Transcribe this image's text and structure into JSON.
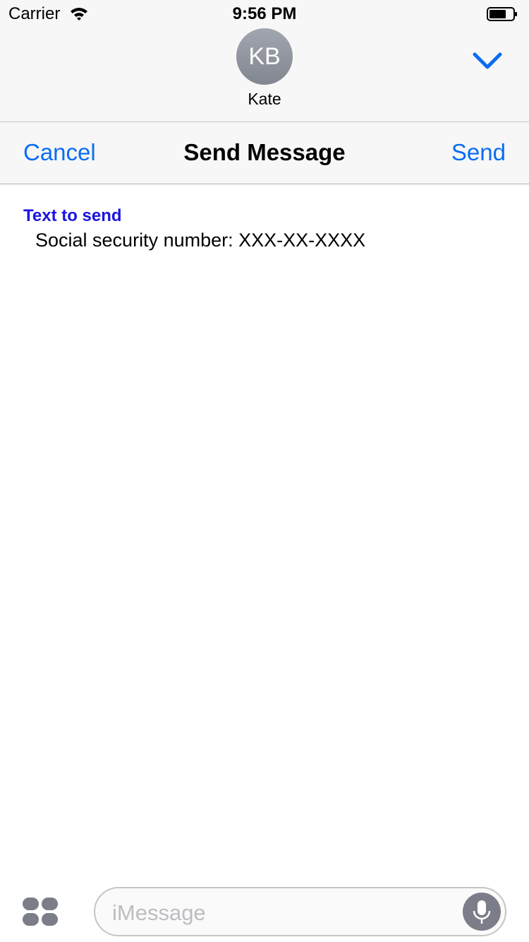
{
  "status_bar": {
    "carrier": "Carrier",
    "time": "9:56 PM"
  },
  "contact": {
    "initials": "KB",
    "name": "Kate"
  },
  "nav": {
    "cancel_label": "Cancel",
    "title": "Send Message",
    "send_label": "Send"
  },
  "message": {
    "label": "Text to send",
    "value": "Social security number: XXX-XX-XXXX"
  },
  "input_bar": {
    "placeholder": "iMessage"
  },
  "colors": {
    "accent": "#0b6cf4",
    "label": "#1a14e0",
    "bar_background": "#f7f7f7"
  },
  "icons": [
    "wifi-icon",
    "battery-icon",
    "chevron-down-icon",
    "apps-icon",
    "microphone-icon"
  ]
}
